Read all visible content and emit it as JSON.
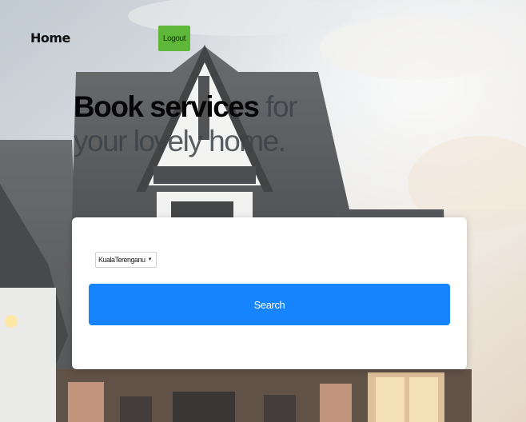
{
  "nav": {
    "home_label": "Home",
    "logout_label": "Logout"
  },
  "hero": {
    "bold": "Book services",
    "rest": "for your lovely home."
  },
  "search": {
    "location_selected": "KualaTerenganu",
    "button_label": "Search"
  },
  "colors": {
    "logout": "#5fb73a",
    "search_button": "#1684fc",
    "card": "#ffffff"
  }
}
